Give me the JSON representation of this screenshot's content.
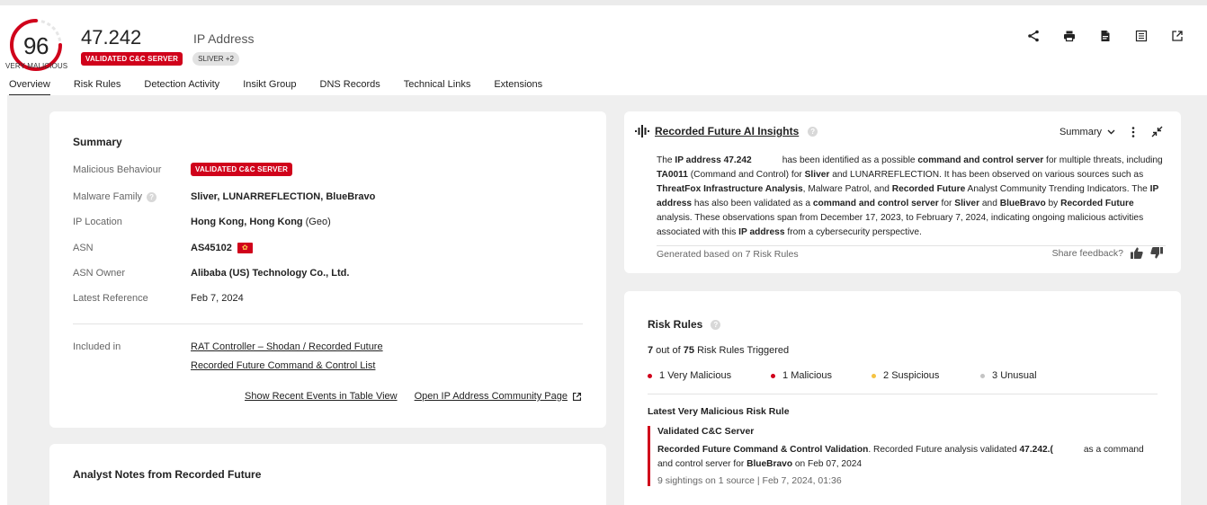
{
  "header": {
    "score": "96",
    "risk_label": "VERY MALICIOUS",
    "entity_name": "47.242",
    "entity_type": "IP Address",
    "badges": [
      "VALIDATED C&C SERVER",
      "SLIVER +2"
    ],
    "colors": {
      "accent": "#d0021b"
    }
  },
  "tabs": [
    "Overview",
    "Risk Rules",
    "Detection Activity",
    "Insikt Group",
    "DNS Records",
    "Technical Links",
    "Extensions"
  ],
  "actions": [
    "share-icon",
    "print-icon",
    "pdf-icon",
    "list-view-icon",
    "external-link-icon"
  ],
  "summary": {
    "title": "Summary",
    "rows": [
      {
        "label": "Malicious Behaviour",
        "value": "VALIDATED C&C SERVER"
      },
      {
        "label": "Malware Family",
        "value": "Sliver, LUNARREFLECTION, BlueBravo"
      },
      {
        "label": "IP Location",
        "value": "Hong Kong, Hong Kong",
        "suffix": "(Geo)"
      },
      {
        "label": "ASN",
        "value": "AS45102"
      },
      {
        "label": "ASN Owner",
        "value": "Alibaba (US) Technology Co., Ltd."
      },
      {
        "label": "Latest Reference",
        "value": "Feb 7, 2024"
      }
    ],
    "included_label": "Included in",
    "included": [
      "RAT Controller – Shodan / Recorded Future",
      "Recorded Future Command & Control List"
    ],
    "show_events": "Show Recent Events in Table View",
    "open_community": "Open IP Address Community Page"
  },
  "notes": {
    "title": "Analyst Notes from Recorded Future"
  },
  "ai": {
    "title": "Recorded Future AI Insights",
    "dropdown": "Summary",
    "segments": [
      {
        "t": "The ",
        "b": false
      },
      {
        "t": "IP address 47.242",
        "b": true
      },
      {
        "t": "            has been identified as a possible ",
        "b": false
      },
      {
        "t": "command and control server",
        "b": true
      },
      {
        "t": " for multiple threats, including ",
        "b": false
      },
      {
        "t": "TA0011",
        "b": true
      },
      {
        "t": " (Command and Control) for ",
        "b": false
      },
      {
        "t": "Sliver",
        "b": true
      },
      {
        "t": " and LUNARREFLECTION. It has been observed on various sources such as ",
        "b": false
      },
      {
        "t": "ThreatFox Infrastructure Analysis",
        "b": true
      },
      {
        "t": ", Malware Patrol, and ",
        "b": false
      },
      {
        "t": "Recorded Future",
        "b": true
      },
      {
        "t": " Analyst Community Trending Indicators. The ",
        "b": false
      },
      {
        "t": "IP address",
        "b": true
      },
      {
        "t": " has also been validated as a ",
        "b": false
      },
      {
        "t": "command and control server",
        "b": true
      },
      {
        "t": " for ",
        "b": false
      },
      {
        "t": "Sliver",
        "b": true
      },
      {
        "t": " and ",
        "b": false
      },
      {
        "t": "BlueBravo",
        "b": true
      },
      {
        "t": " by ",
        "b": false
      },
      {
        "t": "Recorded Future",
        "b": true
      },
      {
        "t": " analysis. These observations span from December 17, 2023, to February 7, 2024, indicating ongoing malicious activities associated with this ",
        "b": false
      },
      {
        "t": "IP address",
        "b": true
      },
      {
        "t": " from a cybersecurity perspective.",
        "b": false
      }
    ],
    "generated": "Generated based on 7 Risk Rules",
    "feedback": "Share feedback?"
  },
  "risk": {
    "title": "Risk Rules",
    "triggered_a": "7",
    "triggered_mid": " out of ",
    "triggered_b": "75",
    "triggered_c": " Risk Rules Triggered",
    "legend": [
      {
        "count": "1",
        "label": "Very Malicious",
        "color": "#d0021b"
      },
      {
        "count": "1",
        "label": "Malicious",
        "color": "#d0021b"
      },
      {
        "count": "2",
        "label": "Suspicious",
        "color": "#f5c342"
      },
      {
        "count": "3",
        "label": "Unusual",
        "color": "#c4c4c4"
      }
    ],
    "latest_title": "Latest Very Malicious Risk Rule",
    "rule_name": "Validated C&C Server",
    "rule_desc_a": "Recorded Future Command & Control Validation",
    "rule_desc_b": ". Recorded Future analysis validated ",
    "rule_desc_c": "47.242.(",
    "rule_desc_d": "            as a command and control server for ",
    "rule_desc_e": "BlueBravo",
    "rule_desc_f": " on Feb 07, 2024",
    "sightings": "9 sightings on 1 source | Feb 7, 2024, 01:36"
  }
}
